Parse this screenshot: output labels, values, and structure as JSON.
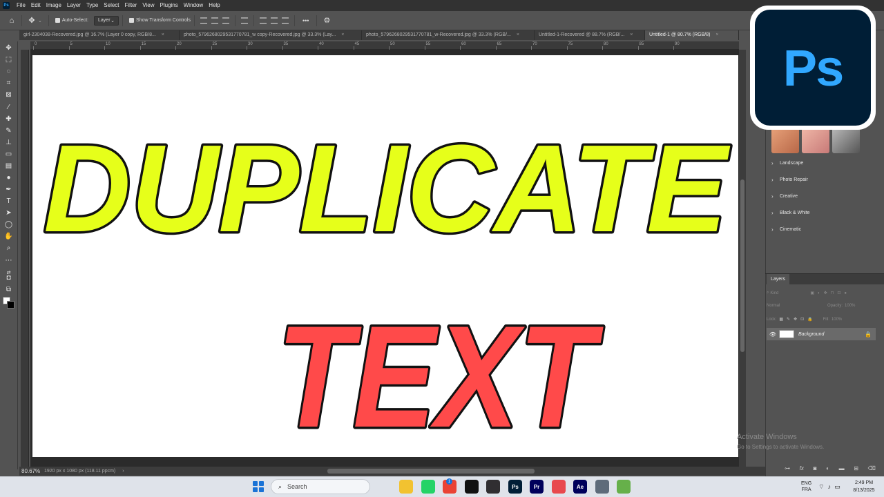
{
  "menu": {
    "logo": "Ps",
    "items": [
      "File",
      "Edit",
      "Image",
      "Layer",
      "Type",
      "Select",
      "Filter",
      "View",
      "Plugins",
      "Window",
      "Help"
    ]
  },
  "options_bar": {
    "auto_select_label": "Auto-Select:",
    "auto_select_target": "Layer",
    "show_transform_label": "Show Transform Controls",
    "more_label": "•••"
  },
  "doc_tabs": [
    {
      "label": "girl-2304038-Recovered.jpg @ 16.7% (Layer 0 copy, RGB/8...",
      "close": "×",
      "active": false
    },
    {
      "label": "photo_5796268029531770781_w copy-Recovered.jpg @ 33.3% (Lay...",
      "close": "×",
      "active": false
    },
    {
      "label": "photo_5796268029531770781_w-Recovered.jpg @ 33.3% (RGB/...",
      "close": "×",
      "active": false
    },
    {
      "label": "Untitled-1-Recovered @ 88.7% (RGB/...",
      "close": "×",
      "active": false
    },
    {
      "label": "Untitled-1 @ 80.7% (RGB/8)",
      "close": "×",
      "active": true
    }
  ],
  "ruler_top_labels": [
    "0",
    "5",
    "10",
    "15",
    "20",
    "25",
    "30",
    "35",
    "40",
    "45",
    "50",
    "55",
    "60",
    "65",
    "70",
    "75",
    "80",
    "85",
    "90"
  ],
  "canvas": {
    "line1": "DUPLICATE",
    "line2": "TEXT",
    "line1_fill": "#e6ff1a",
    "line2_fill": "#ff4a4a",
    "stroke": "#111111",
    "background": "#ffffff"
  },
  "status": {
    "zoom": "80.67%",
    "doc_info": "1920 px x 1080 px (118.11 ppcm)",
    "arrow": "›"
  },
  "presets": [
    {
      "label": "Landscape",
      "chevron": "›"
    },
    {
      "label": "Photo Repair",
      "chevron": "›"
    },
    {
      "label": "Creative",
      "chevron": "›"
    },
    {
      "label": "Black & White",
      "chevron": "›"
    },
    {
      "label": "Cinematic",
      "chevron": "›"
    }
  ],
  "layers_panel": {
    "tab": "Layers",
    "kind_placeholder": "Kind",
    "blend_mode": "Normal",
    "opacity_label": "Opacity:",
    "opacity_value": "100%",
    "lock_label": "Lock:",
    "fill_label": "Fill:",
    "fill_value": "100%",
    "layer_name": "Background",
    "footer_fx": "fx"
  },
  "watermark": {
    "title": "Activate Windows",
    "subtitle": "Go to Settings to activate Windows."
  },
  "badge": {
    "text": "Ps"
  },
  "taskbar": {
    "search_placeholder": "Search",
    "apps": [
      {
        "name": "file-explorer",
        "label": "",
        "color": "#f2c230"
      },
      {
        "name": "whatsapp",
        "label": "",
        "color": "#25d366"
      },
      {
        "name": "chrome",
        "label": "",
        "color": "#ea4335"
      },
      {
        "name": "capcut",
        "label": "",
        "color": "#111111"
      },
      {
        "name": "obs",
        "label": "",
        "color": "#302e31"
      },
      {
        "name": "photoshop",
        "label": "Ps",
        "color": "#001e36"
      },
      {
        "name": "premiere",
        "label": "Pr",
        "color": "#00005b"
      },
      {
        "name": "snipping",
        "label": "",
        "color": "#e8484d"
      },
      {
        "name": "after-effects",
        "label": "Ae",
        "color": "#00005b"
      },
      {
        "name": "calculator",
        "label": "",
        "color": "#5e6b7a"
      },
      {
        "name": "notepad",
        "label": "",
        "color": "#66b04a"
      }
    ],
    "whatsapp_badge": "1",
    "lang_top": "ENG",
    "lang_bottom": "FRA",
    "time": "2:49 PM",
    "date": "8/13/2025"
  }
}
